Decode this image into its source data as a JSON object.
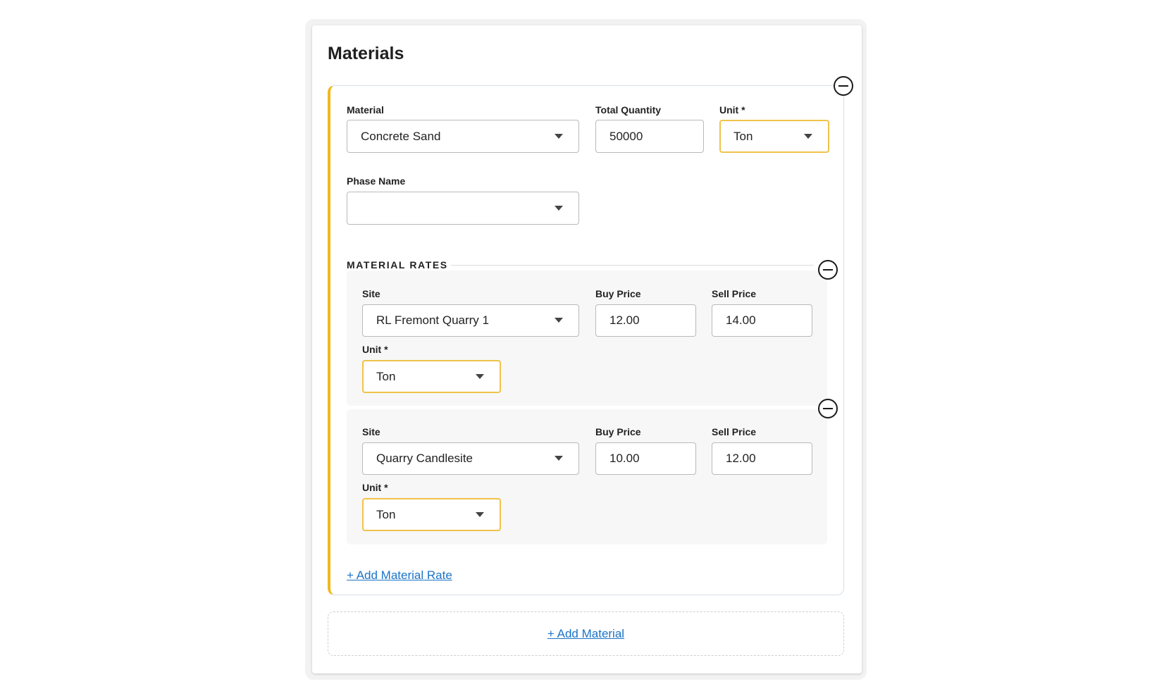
{
  "section": {
    "title": "Materials"
  },
  "material": {
    "material_label": "Material",
    "material_value": "Concrete Sand",
    "quantity_label": "Total Quantity",
    "quantity_value": "50000",
    "unit_label": "Unit *",
    "unit_value": "Ton",
    "phase_label": "Phase Name",
    "phase_value": ""
  },
  "rates": {
    "title": "MATERIAL RATES",
    "items": [
      {
        "site_label": "Site",
        "site_value": "RL Fremont Quarry 1",
        "buy_label": "Buy Price",
        "buy_value": "12.00",
        "sell_label": "Sell Price",
        "sell_value": "14.00",
        "unit_label": "Unit *",
        "unit_value": "Ton"
      },
      {
        "site_label": "Site",
        "site_value": "Quarry Candlesite",
        "buy_label": "Buy Price",
        "buy_value": "10.00",
        "sell_label": "Sell Price",
        "sell_value": "12.00",
        "unit_label": "Unit *",
        "unit_value": "Ton"
      }
    ],
    "add_label": "+ Add Material Rate"
  },
  "add_material_label": "+ Add Material",
  "colors": {
    "accent": "#f0b81e",
    "link": "#1b74c7",
    "highlight_border": "#f0c24a"
  },
  "icons": {
    "remove": "minus-circle-icon",
    "dropdown": "chevron-down-icon"
  }
}
